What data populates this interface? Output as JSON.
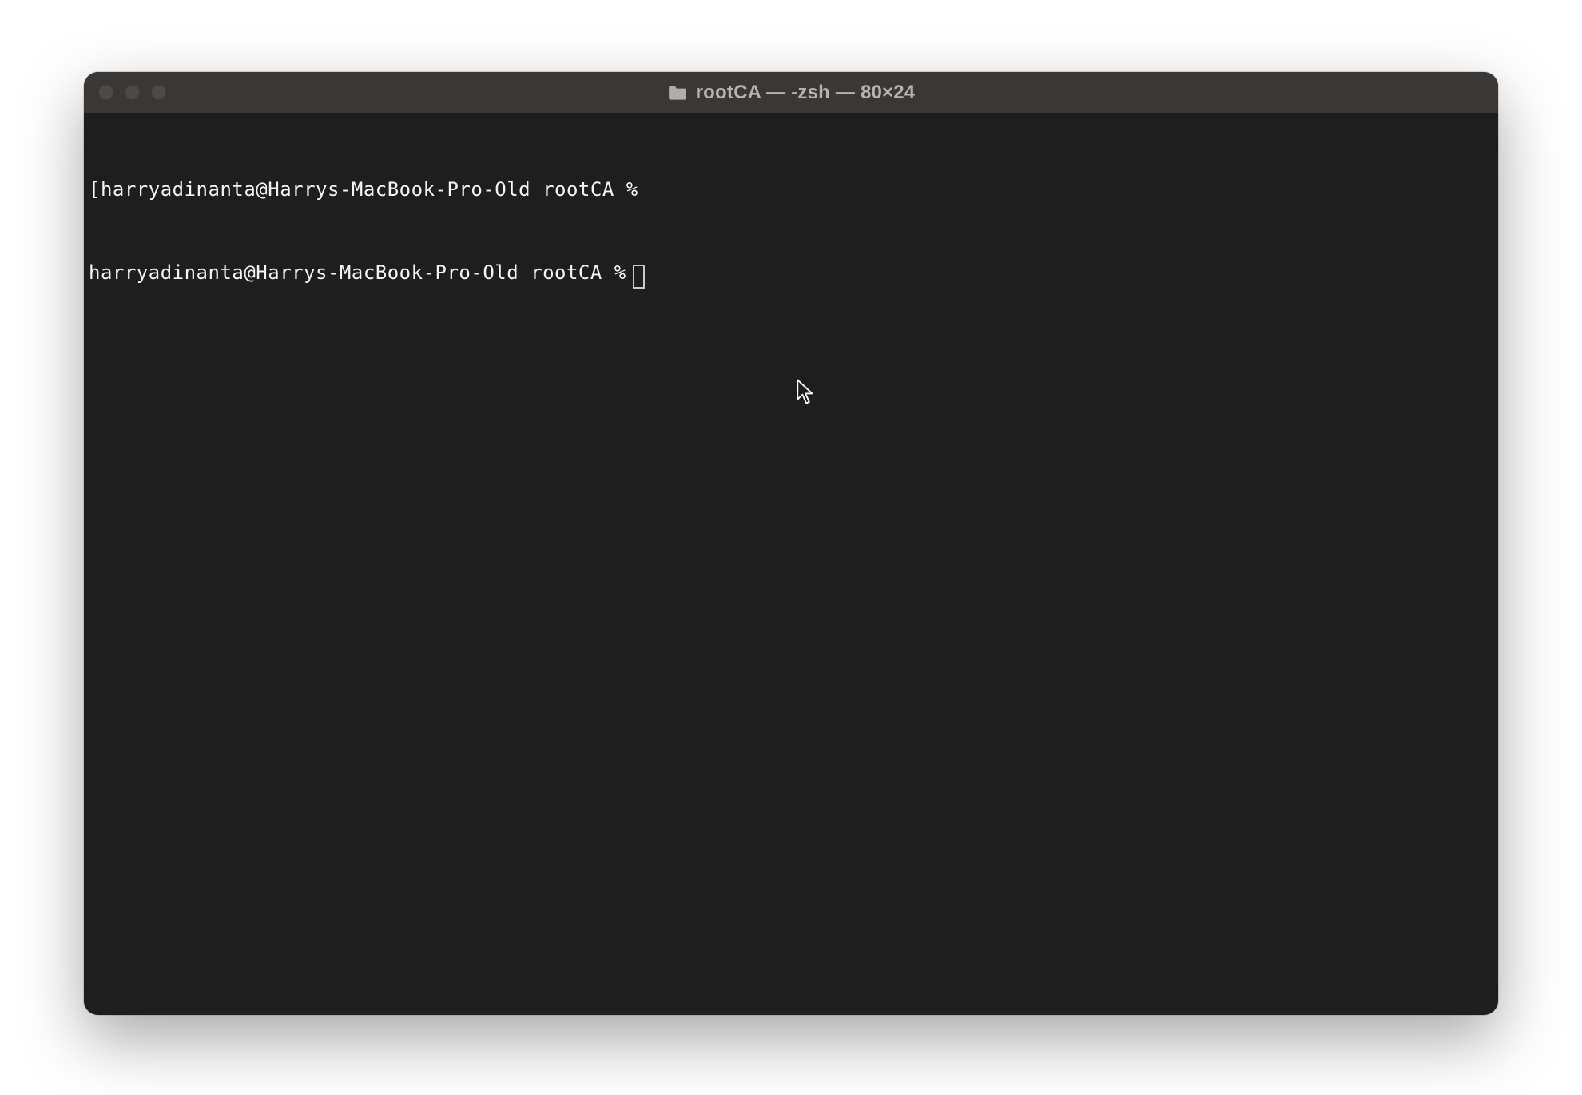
{
  "window": {
    "title": "rootCA — -zsh — 80×24"
  },
  "terminal": {
    "lines": [
      {
        "bracket": "[",
        "prompt": "harryadinanta@Harrys-MacBook-Pro-Old rootCA %",
        "has_cursor": false
      },
      {
        "bracket": "",
        "prompt": "harryadinanta@Harrys-MacBook-Pro-Old rootCA %",
        "has_cursor": true
      }
    ]
  }
}
